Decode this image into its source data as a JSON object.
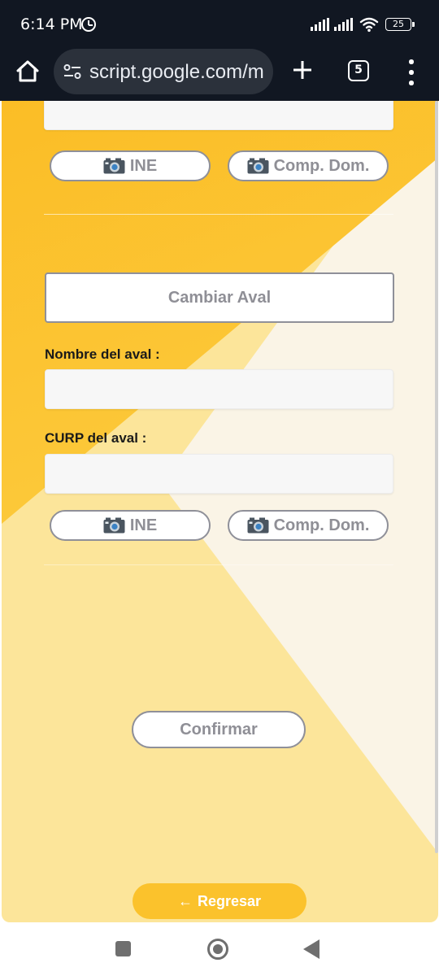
{
  "status_bar": {
    "time": "6:14 PM",
    "battery": "25",
    "icons": [
      "alarm-icon",
      "signal-icon",
      "signal-icon",
      "wifi-icon",
      "battery-icon"
    ]
  },
  "browser": {
    "url": "script.google.com/m",
    "tab_count": "5",
    "icons": [
      "home-icon",
      "tune-icon",
      "plus-icon",
      "tabs-icon",
      "more-vert-icon"
    ]
  },
  "form": {
    "top_buttons": {
      "ine": "INE",
      "comp_dom": "Comp. Dom."
    },
    "change_guarantor_button": "Cambiar Aval",
    "guarantor_name": {
      "label": "Nombre del aval :",
      "value": ""
    },
    "guarantor_curp": {
      "label": "CURP del aval :",
      "value": ""
    },
    "bottom_buttons": {
      "ine": "INE",
      "comp_dom": "Comp. Dom."
    },
    "confirm_button": "Confirmar",
    "back_button": "Regresar",
    "back_arrow": "←"
  },
  "colors": {
    "accent_yellow": "#fbc22c",
    "light_yellow": "#fce59a",
    "cream": "#faf4e6",
    "button_border": "#8f9099"
  },
  "nav_bar": {
    "icons": [
      "recents-icon",
      "home-circle-icon",
      "back-triangle-icon"
    ]
  }
}
